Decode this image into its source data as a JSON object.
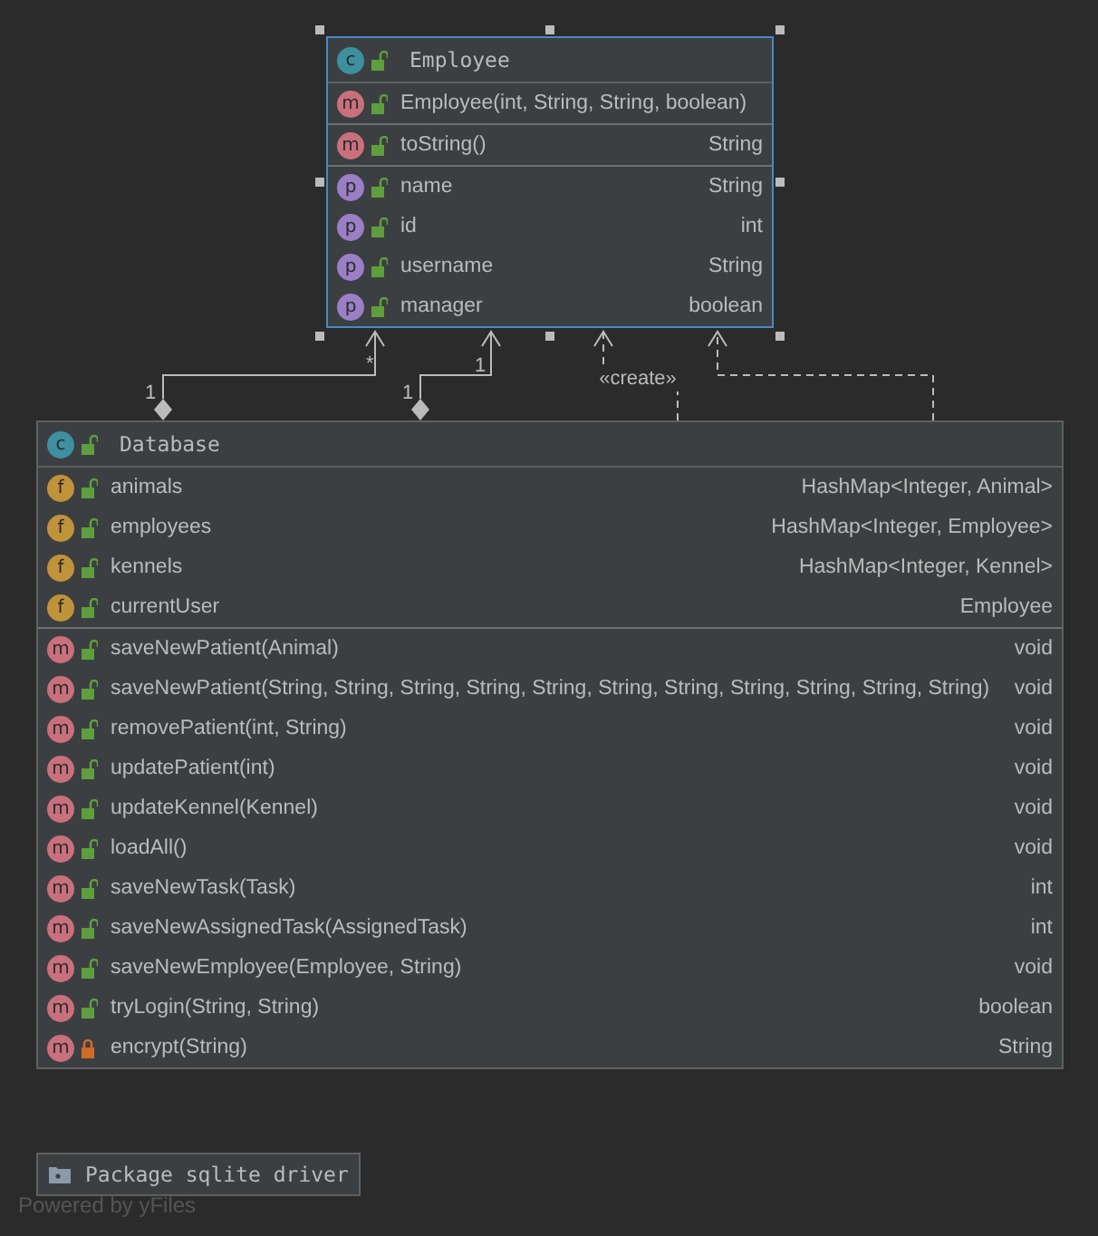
{
  "classes": [
    {
      "badge": "c",
      "name": "Employee",
      "private": false,
      "selected": true,
      "sections": [
        [
          {
            "kind": "method",
            "badge": "m",
            "private": false,
            "name": "Employee(int, String, String, boolean)"
          }
        ],
        [
          {
            "kind": "method",
            "badge": "m",
            "private": false,
            "name": "toString()",
            "type": "String"
          }
        ],
        [
          {
            "kind": "property",
            "badge": "p",
            "private": false,
            "name": "name",
            "type": "String"
          },
          {
            "kind": "property",
            "badge": "p",
            "private": false,
            "name": "id",
            "type": "int"
          },
          {
            "kind": "property",
            "badge": "p",
            "private": false,
            "name": "username",
            "type": "String"
          },
          {
            "kind": "property",
            "badge": "p",
            "private": false,
            "name": "manager",
            "type": "boolean"
          }
        ]
      ]
    },
    {
      "badge": "c",
      "name": "Database",
      "private": false,
      "selected": false,
      "sections": [
        [
          {
            "kind": "field",
            "badge": "f",
            "private": false,
            "name": "animals",
            "type": "HashMap<Integer, Animal>"
          },
          {
            "kind": "field",
            "badge": "f",
            "private": false,
            "name": "employees",
            "type": "HashMap<Integer, Employee>"
          },
          {
            "kind": "field",
            "badge": "f",
            "private": false,
            "name": "kennels",
            "type": "HashMap<Integer, Kennel>"
          },
          {
            "kind": "field",
            "badge": "f",
            "private": false,
            "name": "currentUser",
            "type": "Employee"
          }
        ],
        [
          {
            "kind": "method",
            "badge": "m",
            "private": false,
            "name": "saveNewPatient(Animal)",
            "type": "void"
          },
          {
            "kind": "method",
            "badge": "m",
            "private": false,
            "name": "saveNewPatient(String, String, String, String, String, String, String, String, String, String, String)",
            "type": "void"
          },
          {
            "kind": "method",
            "badge": "m",
            "private": false,
            "name": "removePatient(int, String)",
            "type": "void"
          },
          {
            "kind": "method",
            "badge": "m",
            "private": false,
            "name": "updatePatient(int)",
            "type": "void"
          },
          {
            "kind": "method",
            "badge": "m",
            "private": false,
            "name": "updateKennel(Kennel)",
            "type": "void"
          },
          {
            "kind": "method",
            "badge": "m",
            "private": false,
            "name": "loadAll()",
            "type": "void"
          },
          {
            "kind": "method",
            "badge": "m",
            "private": false,
            "name": "saveNewTask(Task)",
            "type": "int"
          },
          {
            "kind": "method",
            "badge": "m",
            "private": false,
            "name": "saveNewAssignedTask(AssignedTask)",
            "type": "int"
          },
          {
            "kind": "method",
            "badge": "m",
            "private": false,
            "name": "saveNewEmployee(Employee, String)",
            "type": "void"
          },
          {
            "kind": "method",
            "badge": "m",
            "private": false,
            "name": "tryLogin(String, String)",
            "type": "boolean"
          },
          {
            "kind": "method",
            "badge": "m",
            "private": true,
            "name": "encrypt(String)",
            "type": "String"
          }
        ]
      ]
    }
  ],
  "edges": [
    {
      "kind": "aggregation",
      "source_label": "1",
      "target_label": "*"
    },
    {
      "kind": "aggregation",
      "source_label": "1",
      "target_label": "1"
    },
    {
      "kind": "dependency",
      "label": "«create»"
    },
    {
      "kind": "dependency"
    }
  ],
  "package": {
    "name": "Package sqlite driver"
  },
  "footer": "Powered by yFiles"
}
